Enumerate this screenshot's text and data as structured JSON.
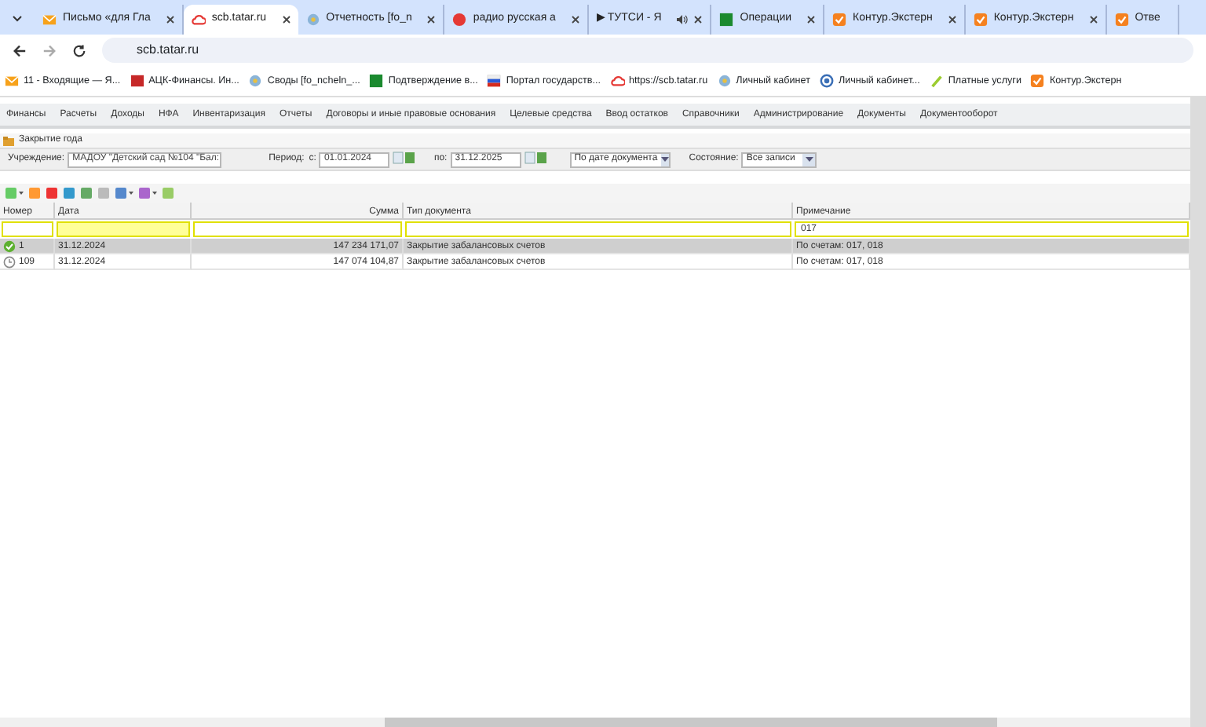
{
  "browser": {
    "tabs": [
      {
        "label": "Письмо «для Гла",
        "selected": false
      },
      {
        "label": "scb.tatar.ru",
        "selected": true
      },
      {
        "label": "Отчетность [fo_n",
        "selected": false
      },
      {
        "label": "радио русская а",
        "selected": false
      },
      {
        "label": "▶ ТУТСИ - Я",
        "selected": false
      },
      {
        "label": "Операции",
        "selected": false
      },
      {
        "label": "Контур.Экстерн",
        "selected": false
      },
      {
        "label": "Контур.Экстерн",
        "selected": false
      },
      {
        "label": "Отве",
        "selected": false
      }
    ],
    "address": "scb.tatar.ru",
    "bookmarks": [
      "11 - Входящие — Я...",
      "АЦК-Финансы. Ин...",
      "Своды [fo_ncheln_...",
      "Подтверждение в...",
      "Портал государств...",
      "https://scb.tatar.ru",
      "Личный кабинет",
      "Личный кабинет...",
      "Платные услуги",
      "Контур.Экстерн"
    ]
  },
  "menu": [
    "Финансы",
    "Расчеты",
    "Доходы",
    "НФА",
    "Инвентаризация",
    "Отчеты",
    "Договоры и иные правовые основания",
    "Целевые средства",
    "Ввод остатков",
    "Справочники",
    "Администрирование",
    "Документы",
    "Документооборот"
  ],
  "page_title": "Закрытие года",
  "filters": {
    "institution_label": "Учреждение:",
    "institution": "МАДОУ \"Детский сад №104 \"Бал:",
    "period_label": "Период:",
    "from_label": "с:",
    "from": "01.01.2024",
    "to_label": "по:",
    "to": "31.12.2025",
    "sort": "По дате документа",
    "state_label": "Состояние:",
    "state": "Все записи"
  },
  "table": {
    "columns": [
      "Номер",
      "Дата",
      "Сумма",
      "Тип документа",
      "Примечание"
    ],
    "column_filters": [
      {
        "highlighted": false
      },
      {
        "highlighted": true
      },
      {
        "highlighted": false
      },
      {
        "highlighted": false
      },
      {
        "value": "017",
        "highlighted": false
      }
    ],
    "rows": [
      {
        "number": "1",
        "posted": true,
        "selected": true,
        "date": "31.12.2024",
        "sum": "147 234 171,07",
        "type": "Закрытие забалансовых счетов",
        "note": "По счетам: 017, 018"
      },
      {
        "number": "109",
        "posted": false,
        "selected": false,
        "date": "31.12.2024",
        "sum": "147 074 104,87",
        "type": "Закрытие забалансовых счетов",
        "note": "По счетам: 017, 018"
      }
    ]
  }
}
